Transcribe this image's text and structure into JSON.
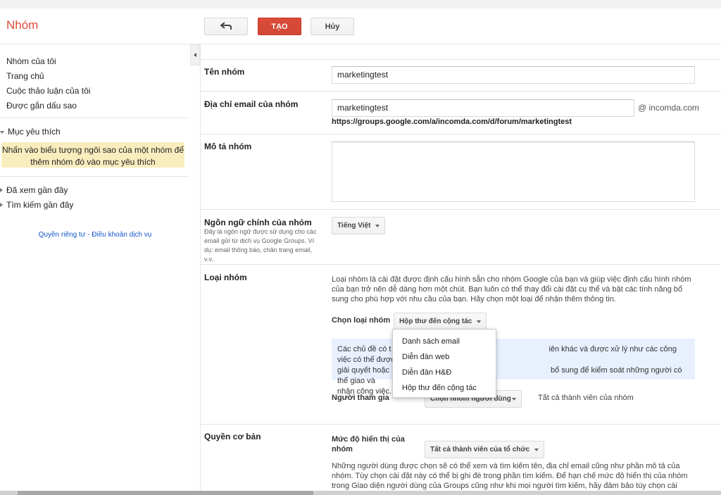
{
  "header": {
    "brand": "Nhóm",
    "back_icon": "undo-arrow-icon",
    "create_label": "TẠO",
    "cancel_label": "Hủy"
  },
  "sidebar": {
    "nav": [
      "Nhóm của tôi",
      "Trang chủ",
      "Cuộc thảo luận của tôi",
      "Được gắn dấu sao"
    ],
    "favorites_title": "Mục yêu thích",
    "favorites_hint_line1": "Nhấn vào biểu tượng ngôi sao của một nhóm để",
    "favorites_hint_line2": "thêm nhóm đó vào mục yêu thích",
    "recently_viewed": "Đã xem gần đây",
    "recent_searches": "Tìm kiếm gần đây",
    "privacy_link": "Quyền riêng tư - Điều khoản dịch vụ"
  },
  "form": {
    "name_label": "Tên nhóm",
    "name_value": "marketingtest",
    "email_label": "Địa chỉ email của nhóm",
    "email_value": "marketingtest",
    "email_domain": "@ incomda.com",
    "group_url": "https://groups.google.com/a/incomda.com/d/forum/marketingtest",
    "desc_label": "Mô tả nhóm",
    "desc_value": "",
    "lang_label": "Ngôn ngữ chính của nhóm",
    "lang_help": "Đây là ngôn ngữ được sử dụng cho các email gửi từ dịch vụ Google Groups. Ví dụ: email thông báo, chân trang email, v.v..",
    "lang_value": "Tiếng Việt",
    "type_label": "Loại nhóm",
    "type_desc": "Loại nhóm là cài đặt được định cấu hình sẵn cho nhóm Google của bạn và giúp việc định cấu hình nhóm của bạn trở nên dễ dàng hơn một chút. Bạn luôn có thể thay đổi cài đặt cụ thể và bật các tính năng bổ sung cho phù hợp với nhu cầu của bạn. Hãy chọn một loại để nhận thêm thông tin.",
    "choose_type_label": "Chọn loại nhóm",
    "choose_type_value": "Hộp thư đến cộng tác",
    "info_line1a": "Các chủ đề có t",
    "info_line1b": "iên khác và được xử lý như các công việc có thể được",
    "info_line2a": "giải quyết hoặc",
    "info_line2b": "bổ sung để kiểm soát những người có thể giao và",
    "info_line3": "nhận công việc.",
    "participants_label": "Người tham gia",
    "participants_select": "Chọn nhóm người dùng",
    "participants_value": "Tất cả thành viên của nhóm",
    "basic_perm_label": "Quyền cơ bản",
    "visibility_label_1": "Mức độ hiển thị của",
    "visibility_label_2": "nhóm",
    "visibility_value": "Tất cả thành viên của tổ chức",
    "visibility_desc_1": "Những người dùng được chọn sẽ có thể xem và tìm kiếm tên, địa chỉ email cũng như phần mô tả của",
    "visibility_desc_2": "nhóm. Tùy chọn cài đặt này có thể bị ghi đè trong phần tìm kiếm. Để hạn chế mức độ hiển thị của nhóm",
    "visibility_desc_3": "trong Giao diện người dùng của Groups cũng như khi mọi người tìm kiếm, hãy đảm bảo tùy chọn cài"
  },
  "dropdown": {
    "options": [
      "Danh sách email",
      "Diễn đàn web",
      "Diễn đàn H&Đ",
      "Hộp thư đến cộng tác"
    ]
  },
  "colors": {
    "brand": "#dd4b39",
    "primary_button": "#d14836",
    "hint_bg": "#f9edbe",
    "info_bg": "#e8f0fe",
    "link": "#1155cc"
  }
}
